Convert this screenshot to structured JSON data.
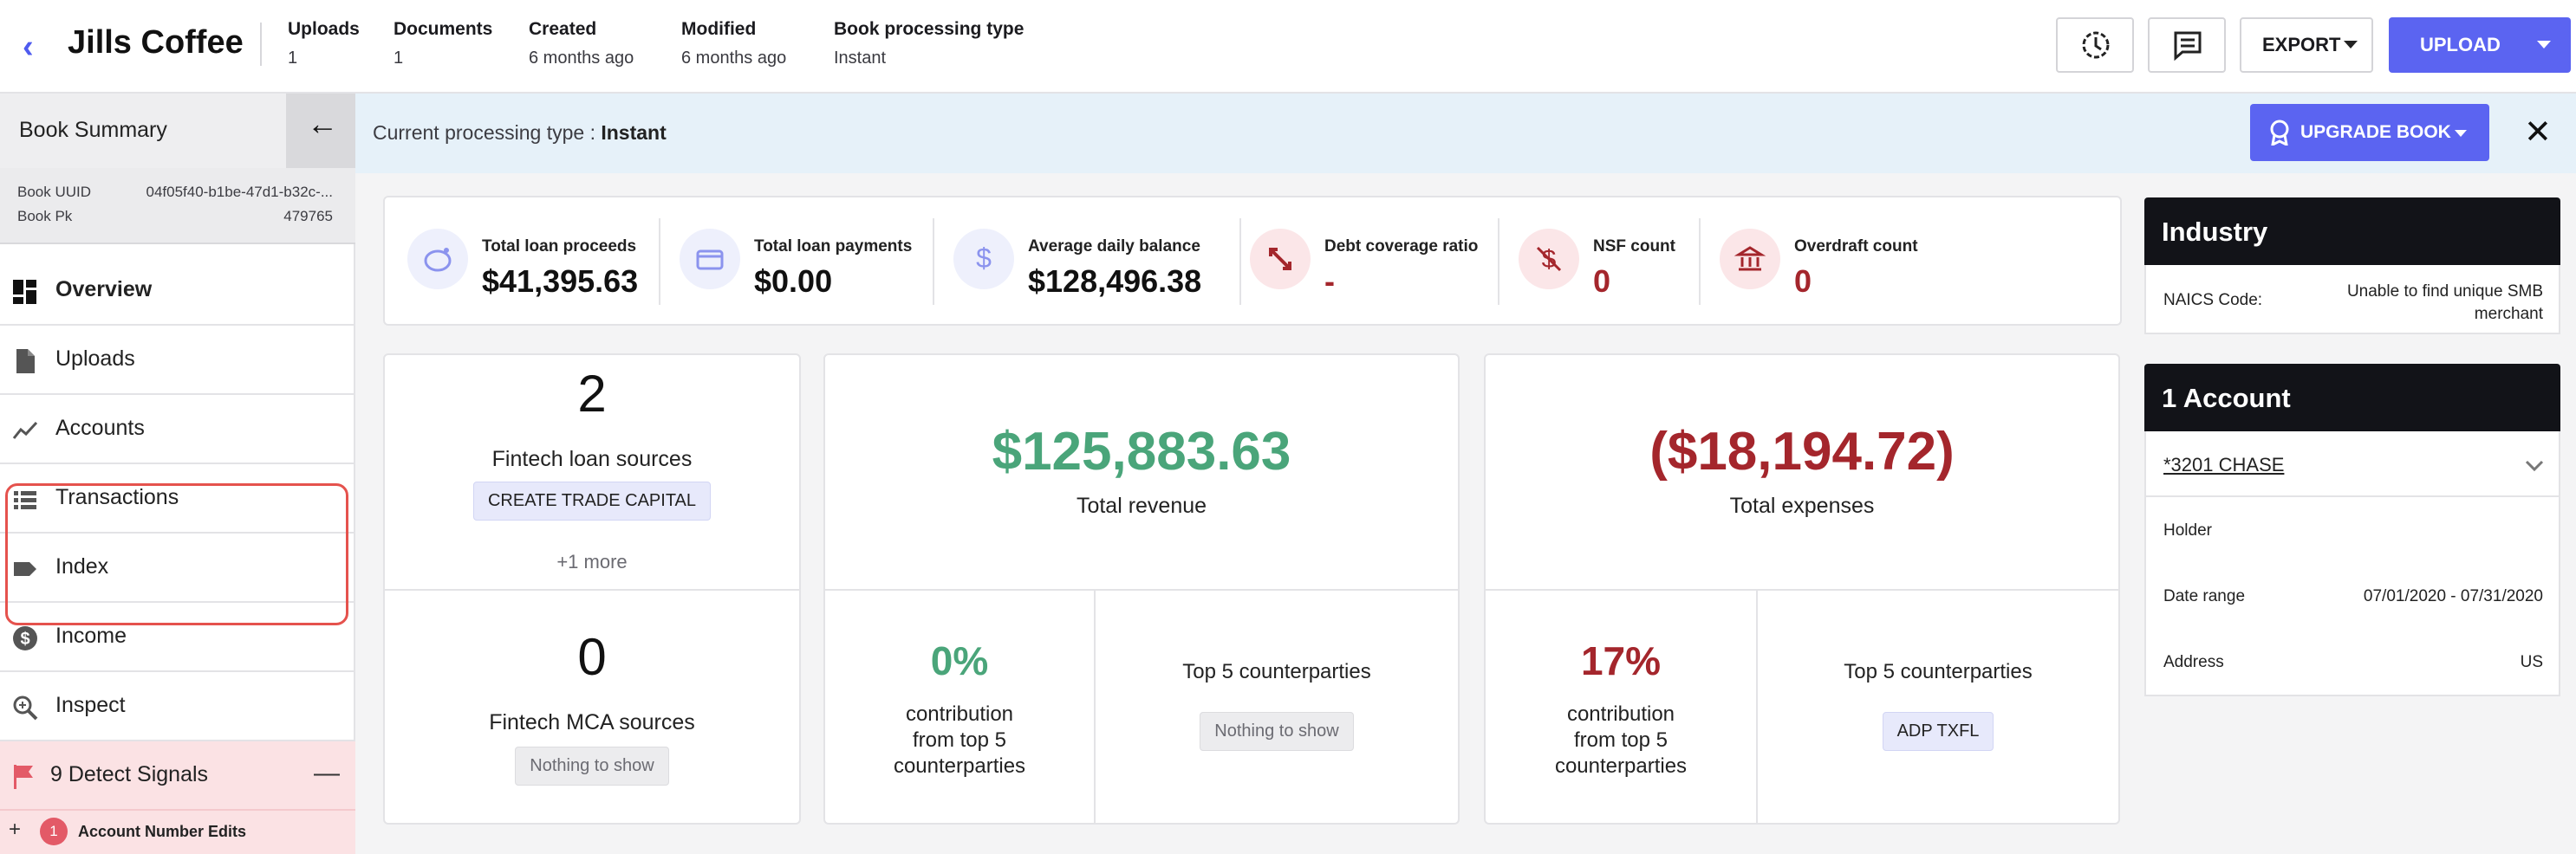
{
  "header": {
    "title": "Jills Coffee",
    "meta": [
      {
        "label": "Uploads",
        "value": "1"
      },
      {
        "label": "Documents",
        "value": "1"
      },
      {
        "label": "Created",
        "value": "6 months ago"
      },
      {
        "label": "Modified",
        "value": "6 months ago"
      },
      {
        "label": "Book processing type",
        "value": "Instant"
      }
    ],
    "export_label": "EXPORT",
    "upload_label": "UPLOAD"
  },
  "sidebar": {
    "title": "Book Summary",
    "book_uuid_label": "Book UUID",
    "book_uuid_value": "04f05f40-b1be-47d1-b32c-...",
    "book_pk_label": "Book Pk",
    "book_pk_value": "479765",
    "items": [
      {
        "label": "Overview",
        "icon": "dashboard-icon"
      },
      {
        "label": "Uploads",
        "icon": "document-icon"
      },
      {
        "label": "Accounts",
        "icon": "trend-line-icon"
      },
      {
        "label": "Transactions",
        "icon": "list-icon"
      },
      {
        "label": "Index",
        "icon": "tag-icon"
      },
      {
        "label": "Income",
        "icon": "dollar-circle-icon"
      },
      {
        "label": "Inspect",
        "icon": "zoom-in-icon"
      }
    ],
    "signals_label": "9 Detect Signals",
    "signal_row_count": "1",
    "signal_row_label": "Account Number Edits"
  },
  "banner": {
    "prefix": "Current processing type : ",
    "type": "Instant",
    "upgrade_label": "UPGRADE BOOK"
  },
  "kpis": [
    {
      "label": "Total loan proceeds",
      "value": "$41,395.63",
      "icon": "piggy-bank-icon"
    },
    {
      "label": "Total loan payments",
      "value": "$0.00",
      "icon": "credit-card-icon"
    },
    {
      "label": "Average daily balance",
      "value": "$128,496.38",
      "icon": "dollar-icon"
    },
    {
      "label": "Debt coverage ratio",
      "value": "-",
      "icon": "compress-arrows-icon"
    },
    {
      "label": "NSF count",
      "value": "0",
      "icon": "no-money-icon"
    },
    {
      "label": "Overdraft count",
      "value": "0",
      "icon": "bank-icon"
    }
  ],
  "fintech": {
    "loan_count": "2",
    "loan_label": "Fintech loan sources",
    "create_label": "CREATE TRADE CAPITAL",
    "more_label": "+1 more",
    "mca_count": "0",
    "mca_label": "Fintech MCA sources",
    "mca_empty": "Nothing to show"
  },
  "revenue": {
    "amount": "$125,883.63",
    "label": "Total revenue",
    "pct": "0%",
    "pct_label": "contribution from top 5 counterparties",
    "top_label": "Top 5 counterparties",
    "top_value": "Nothing to show"
  },
  "expenses": {
    "amount": "($18,194.72)",
    "label": "Total expenses",
    "pct": "17%",
    "pct_label": "contribution from top 5 counterparties",
    "top_label": "Top 5 counterparties",
    "top_value": "ADP TXFL"
  },
  "industry": {
    "title": "Industry",
    "naics_label": "NAICS Code:",
    "naics_value": "Unable to find unique SMB merchant"
  },
  "account": {
    "title": "1 Account",
    "name": "*3201 CHASE",
    "holder_label": "Holder",
    "holder_value": "",
    "date_label": "Date range",
    "date_value": "07/01/2020 - 07/31/2020",
    "address_label": "Address",
    "address_value": "US"
  },
  "colors": {
    "accent": "#5b64f1",
    "positive": "#4aa57a",
    "negative": "#a4262c",
    "banner_bg": "#e6f1f9",
    "signal_bg": "#fbe2e4"
  }
}
